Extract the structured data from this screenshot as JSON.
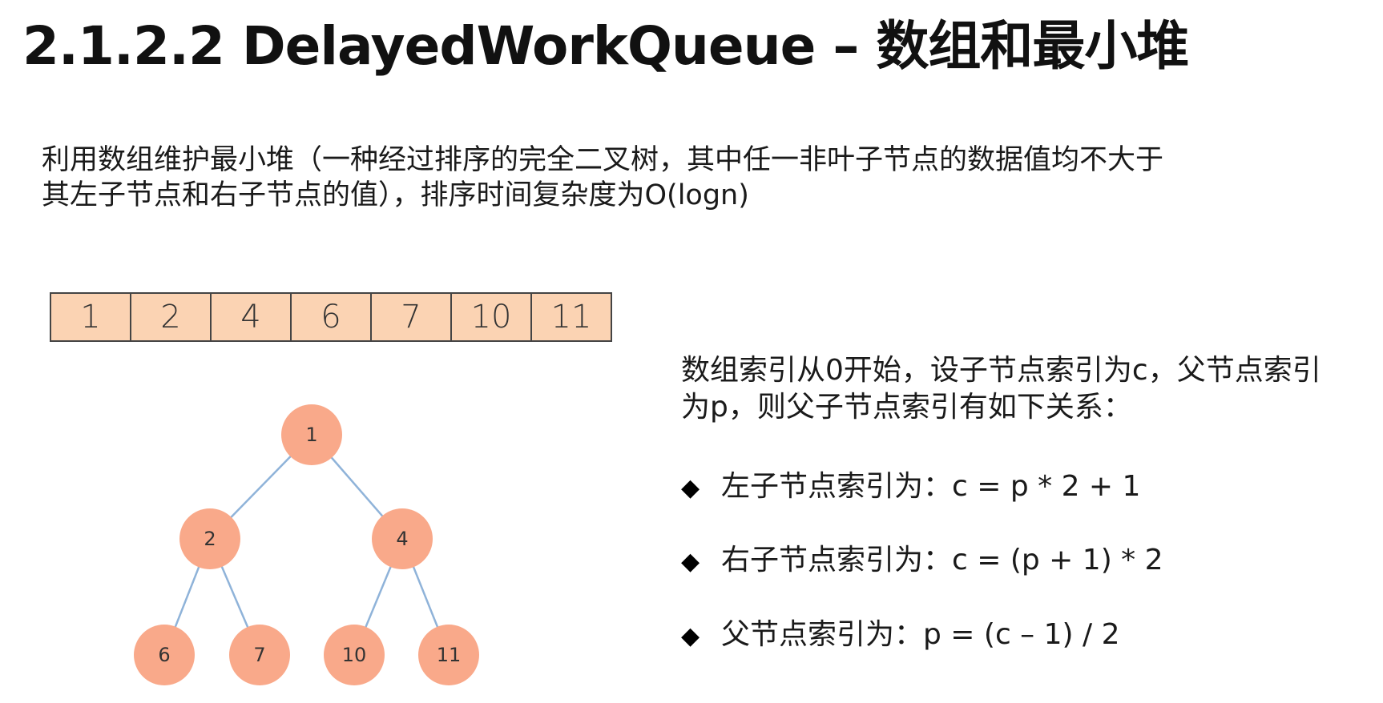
{
  "title": "2.1.2.2 DelayedWorkQueue – 数组和最小堆",
  "intro": {
    "line1": "利用数组维护最小堆（一种经过排序的完全二叉树，其中任一非叶子节点的数据值均不大于",
    "line2": "其左子节点和右子节点的值），排序时间复杂度为O(logn)"
  },
  "array": [
    "1",
    "2",
    "4",
    "6",
    "7",
    "10",
    "11"
  ],
  "tree": {
    "root": "1",
    "level2": [
      "2",
      "4"
    ],
    "level3": [
      "6",
      "7",
      "10",
      "11"
    ],
    "node_color": "#f9a98a",
    "edge_color": "#8fb3d9"
  },
  "array_color": "#fbd3b3",
  "relations": {
    "line1": "数组索引从0开始，设子节点索引为c，父节点索引",
    "line2": "为p，则父子节点索引有如下关系："
  },
  "rules": [
    {
      "bullet": "◆",
      "text": "左子节点索引为：c = p * 2 + 1"
    },
    {
      "bullet": "◆",
      "text": "右子节点索引为：c = (p + 1) * 2"
    },
    {
      "bullet": "◆",
      "text": "父节点索引为：p = (c – 1) / 2"
    }
  ]
}
